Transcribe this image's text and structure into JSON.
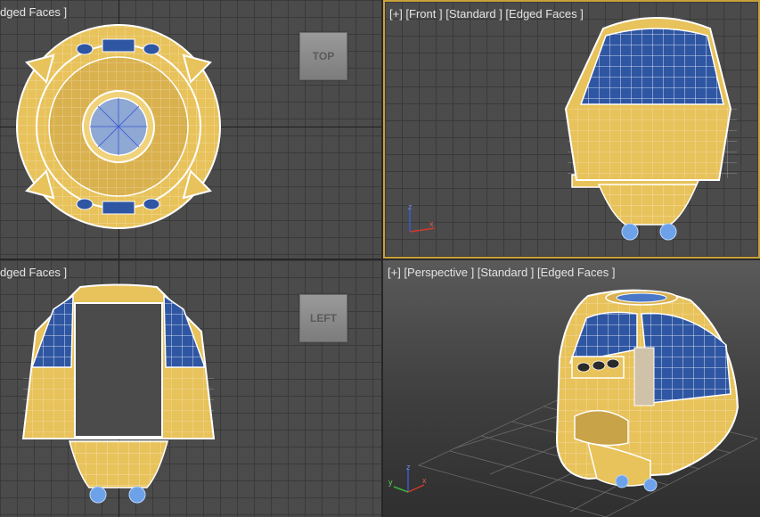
{
  "viewports": {
    "top": {
      "label": "dged Faces ]",
      "cube_label": "TOP"
    },
    "front": {
      "label": "[+] [Front ] [Standard ] [Edged Faces ]"
    },
    "left": {
      "label": "dged Faces ]",
      "cube_label": "LEFT"
    },
    "perspective": {
      "label": "[+] [Perspective ] [Standard ] [Edged Faces ]"
    }
  },
  "colors": {
    "shell": "#e8c25a",
    "glass": "#2f56a3",
    "wire": "#ffffff",
    "active_border": "#c9a13a",
    "axis_x": "#d23a2a",
    "axis_y": "#3ab43a",
    "axis_z": "#3a5ad2"
  },
  "gizmo": {
    "x": "x",
    "y": "y",
    "z": "z"
  }
}
